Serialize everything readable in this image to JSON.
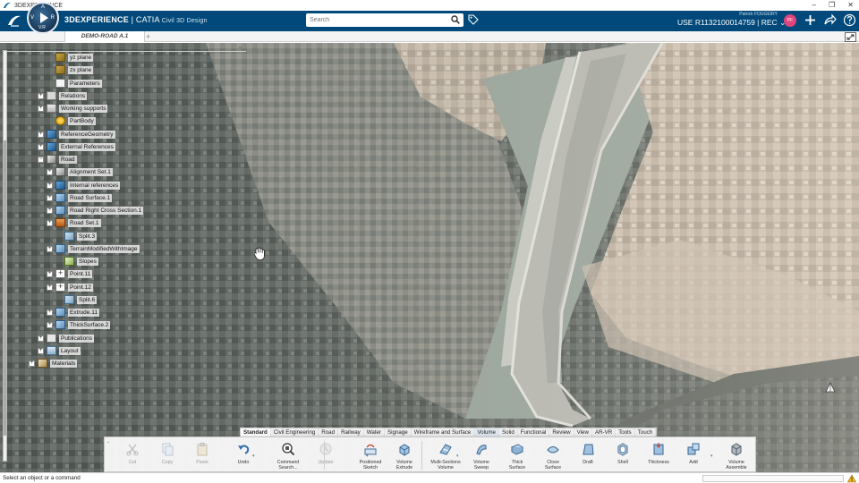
{
  "window": {
    "title": "3DEXPERIENCE",
    "controls": [
      "–",
      "❐",
      "✕"
    ]
  },
  "header": {
    "brand_main": "3DEXPERIENCE",
    "brand_sep": " | ",
    "brand_product": "CATIA",
    "brand_role": "Civil 3D Design",
    "compass_labels": {
      "top": "A",
      "left": "V",
      "right": "R",
      "bottom": "V.R"
    },
    "search_placeholder": "Search",
    "user_name": "Patrick FOUGEIRY",
    "user_context": "USE R1132100014759 | REC",
    "user_context_chevron": "⌄",
    "avatar_label": "PF",
    "colors": {
      "header_bg": "#00497a",
      "avatar": "#e0457b"
    }
  },
  "tabs": [
    {
      "label": "DEMO-ROAD A.1",
      "active": true
    }
  ],
  "tab_add": "+",
  "tree": {
    "collapse_label": "«",
    "nodes": [
      {
        "label": "yz plane",
        "icon": "plane-icon",
        "expander": ""
      },
      {
        "label": "zx plane",
        "icon": "plane-icon",
        "expander": ""
      },
      {
        "label": "Parameters",
        "icon": "parameters-icon",
        "expander": ""
      },
      {
        "label": "Relations",
        "icon": "relations-icon",
        "expander": "+"
      },
      {
        "label": "Working supports",
        "icon": "working-supports-icon",
        "expander": "+"
      },
      {
        "label": "PartBody",
        "icon": "partbody-icon",
        "expander": ""
      },
      {
        "label": "ReferenceGeometry",
        "icon": "reference-geometry-icon",
        "expander": "+"
      },
      {
        "label": "External References",
        "icon": "external-references-icon",
        "expander": "+"
      },
      {
        "label": "Road",
        "icon": "road-icon",
        "expander": "−"
      },
      {
        "label": "Alignment Set.1",
        "icon": "alignment-set-icon",
        "expander": "+"
      },
      {
        "label": "Internal references",
        "icon": "internal-references-icon",
        "expander": "+"
      },
      {
        "label": "Road Surface.1",
        "icon": "road-surface-icon",
        "expander": "+"
      },
      {
        "label": "Road Right Cross Section.1",
        "icon": "cross-section-icon",
        "expander": "+"
      },
      {
        "label": "Road Set.1",
        "icon": "road-set-icon",
        "expander": "+"
      },
      {
        "label": "Split.3",
        "icon": "split-icon",
        "expander": ""
      },
      {
        "label": "TerrainModifiedWithImage",
        "icon": "terrain-icon",
        "expander": "+"
      },
      {
        "label": "Slopes",
        "icon": "slopes-icon",
        "expander": ""
      },
      {
        "label": "Point.11",
        "icon": "point-icon",
        "expander": "+"
      },
      {
        "label": "Point.12",
        "icon": "point-icon",
        "expander": "+"
      },
      {
        "label": "Split.6",
        "icon": "split-icon",
        "expander": ""
      },
      {
        "label": "Extrude.11",
        "icon": "extrude-icon",
        "expander": "+"
      },
      {
        "label": "ThickSurface.2",
        "icon": "thick-surface-icon",
        "expander": "+"
      },
      {
        "label": "Publications",
        "icon": "publications-icon",
        "expander": "+"
      },
      {
        "label": "Layout",
        "icon": "layout-icon",
        "expander": "+"
      },
      {
        "label": "Materials",
        "icon": "materials-icon",
        "expander": "+"
      }
    ]
  },
  "section_tabs": [
    {
      "label": "Standard",
      "state": "active"
    },
    {
      "label": "Civil Engineering",
      "state": ""
    },
    {
      "label": "Road",
      "state": ""
    },
    {
      "label": "Railway",
      "state": ""
    },
    {
      "label": "Water",
      "state": ""
    },
    {
      "label": "Signage",
      "state": ""
    },
    {
      "label": "Wireframe and Surface",
      "state": ""
    },
    {
      "label": "Volume",
      "state": "current"
    },
    {
      "label": "Solid",
      "state": ""
    },
    {
      "label": "Functional",
      "state": ""
    },
    {
      "label": "Review",
      "state": ""
    },
    {
      "label": "View",
      "state": ""
    },
    {
      "label": "AR-VR",
      "state": ""
    },
    {
      "label": "Tools",
      "state": ""
    },
    {
      "label": "Touch",
      "state": ""
    }
  ],
  "actionbar": {
    "commands": [
      {
        "label": "Cut",
        "icon": "cut-icon",
        "enabled": false
      },
      {
        "label": "Copy",
        "icon": "copy-icon",
        "enabled": false
      },
      {
        "label": "Paste",
        "icon": "paste-icon",
        "enabled": false
      },
      {
        "label": "Undo",
        "icon": "undo-icon",
        "enabled": true
      },
      {
        "label": "Command\nSearch...",
        "icon": "command-search-icon",
        "enabled": true
      },
      {
        "label": "Update",
        "icon": "update-icon",
        "enabled": false
      },
      {
        "label": "Positioned\nSketch",
        "icon": "positioned-sketch-icon",
        "enabled": true
      },
      {
        "label": "Volume\nExtrude",
        "icon": "volume-extrude-icon",
        "enabled": true
      },
      {
        "label": "Multi-Sections\nVolume",
        "icon": "multi-sections-volume-icon",
        "enabled": true
      },
      {
        "label": "Volume\nSweep",
        "icon": "volume-sweep-icon",
        "enabled": true
      },
      {
        "label": "Thick\nSurface",
        "icon": "thick-surface-cmd-icon",
        "enabled": true
      },
      {
        "label": "Close\nSurface",
        "icon": "close-surface-icon",
        "enabled": true
      },
      {
        "label": "Draft",
        "icon": "draft-icon",
        "enabled": true
      },
      {
        "label": "Shell",
        "icon": "shell-icon",
        "enabled": true
      },
      {
        "label": "Thickness",
        "icon": "thickness-icon",
        "enabled": true
      },
      {
        "label": "Add",
        "icon": "add-icon",
        "enabled": true
      },
      {
        "label": "Volume\nAssemble",
        "icon": "volume-assemble-icon",
        "enabled": true
      }
    ]
  },
  "status": {
    "prompt": "Select an object or a command"
  }
}
